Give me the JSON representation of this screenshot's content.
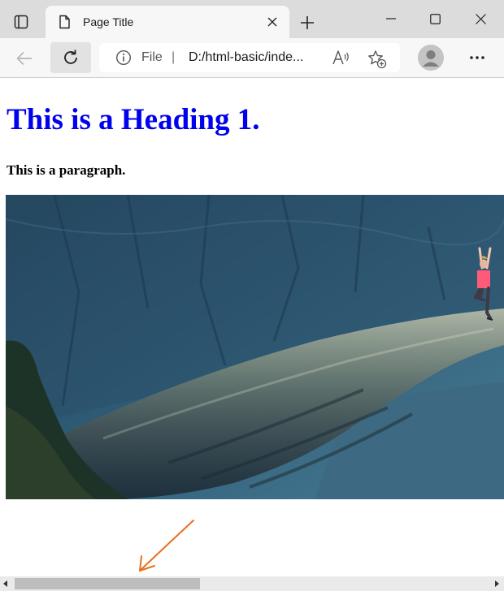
{
  "tab": {
    "title": "Page Title"
  },
  "address": {
    "scheme_label": "File",
    "separator": "|",
    "url": "D:/html-basic/inde..."
  },
  "page": {
    "heading": "This is a Heading 1.",
    "paragraph": "This is a paragraph."
  },
  "scrollbar": {
    "thumb_fraction": 0.39
  },
  "colors": {
    "heading": "#0000ee",
    "annotation_arrow": "#e8701f",
    "photo_shirt": "#ff5b78"
  },
  "icons": {
    "tab_actions": "tab-actions-icon",
    "page": "page-icon",
    "close": "close-icon",
    "new_tab": "plus-icon",
    "back": "back-arrow-icon",
    "refresh": "refresh-icon",
    "info": "info-icon",
    "read_aloud": "read-aloud-icon",
    "favorite": "favorite-add-icon",
    "profile": "profile-icon",
    "more": "more-icon"
  }
}
